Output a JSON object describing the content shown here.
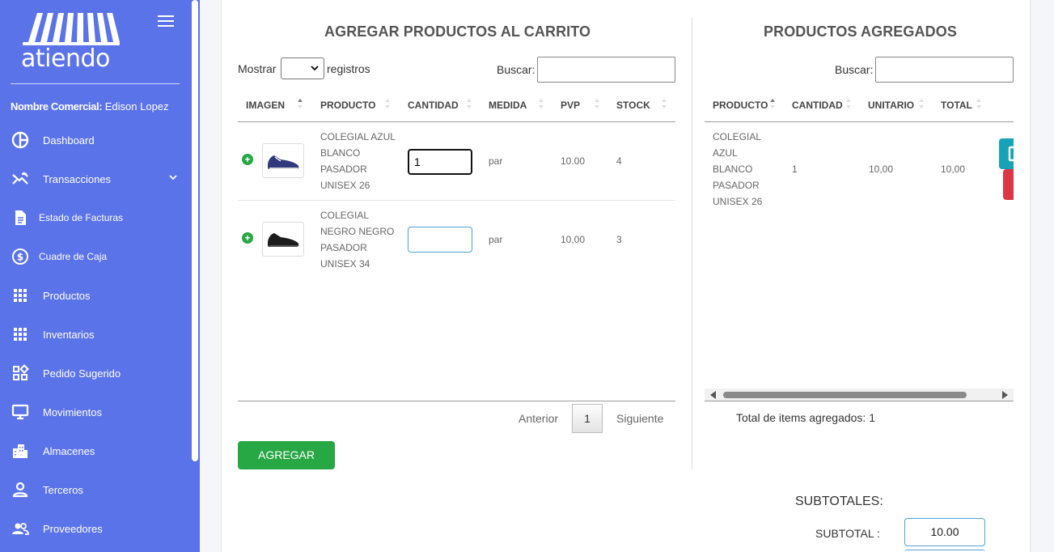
{
  "sidebar": {
    "brand": "atiendo",
    "comercial_label": "Nombre Comercial:",
    "comercial_value": "Edison Lopez",
    "items": [
      {
        "label": "Dashboard",
        "icon": "dashboard-icon"
      },
      {
        "label": "Transacciones",
        "icon": "transactions-icon",
        "has_submenu": true
      },
      {
        "label": "Estado de Facturas",
        "icon": "invoice-icon"
      },
      {
        "label": "Cuadre de Caja",
        "icon": "dollar-icon"
      },
      {
        "label": "Productos",
        "icon": "grid-icon"
      },
      {
        "label": "Inventarios",
        "icon": "grid-icon"
      },
      {
        "label": "Pedido Sugerido",
        "icon": "widgets-icon"
      },
      {
        "label": "Movimientos",
        "icon": "monitor-icon"
      },
      {
        "label": "Almacenes",
        "icon": "building-icon"
      },
      {
        "label": "Terceros",
        "icon": "person-icon"
      },
      {
        "label": "Proveedores",
        "icon": "people-icon"
      }
    ]
  },
  "left_panel": {
    "title": "AGREGAR PRODUCTOS AL CARRITO",
    "show_label": "Mostrar",
    "records_label": "registros",
    "search_label": "Buscar:",
    "search_value": "",
    "columns": [
      "IMAGEN",
      "PRODUCTO",
      "CANTIDAD",
      "MEDIDA",
      "PVP",
      "STOCK"
    ],
    "rows": [
      {
        "product_lines": [
          "COLEGIAL AZUL",
          "BLANCO",
          "PASADOR",
          "UNISEX 26"
        ],
        "quantity": "1",
        "unit": "par",
        "pvp": "10.00",
        "stock": "4"
      },
      {
        "product_lines": [
          "COLEGIAL",
          "NEGRO NEGRO",
          "PASADOR",
          "UNISEX 34"
        ],
        "quantity": "",
        "unit": "par",
        "pvp": "10,00",
        "stock": "3"
      }
    ],
    "pager": {
      "previous": "Anterior",
      "page": "1",
      "next": "Siguiente"
    },
    "add_button": "AGREGAR"
  },
  "right_panel": {
    "title": "PRODUCTOS AGREGADOS",
    "search_label": "Buscar:",
    "search_value": "",
    "columns": [
      "PRODUCTO",
      "CANTIDAD",
      "UNITARIO",
      "TOTAL"
    ],
    "rows": [
      {
        "product_lines": [
          "COLEGIAL",
          "AZUL",
          "BLANCO",
          "PASADOR",
          "UNISEX 26"
        ],
        "quantity": "1",
        "unit_price": "10,00",
        "total": "10,00"
      }
    ],
    "items_total_label": "Total de items agregados: 1"
  },
  "subtotals": {
    "title": "SUBTOTALES:",
    "subtotal_label": "SUBTOTAL :",
    "subtotal_value": "10.00"
  },
  "colors": {
    "sidebar": "#5b73e8",
    "green": "#28a745",
    "teal": "#17a2b8",
    "red": "#dc3545"
  }
}
